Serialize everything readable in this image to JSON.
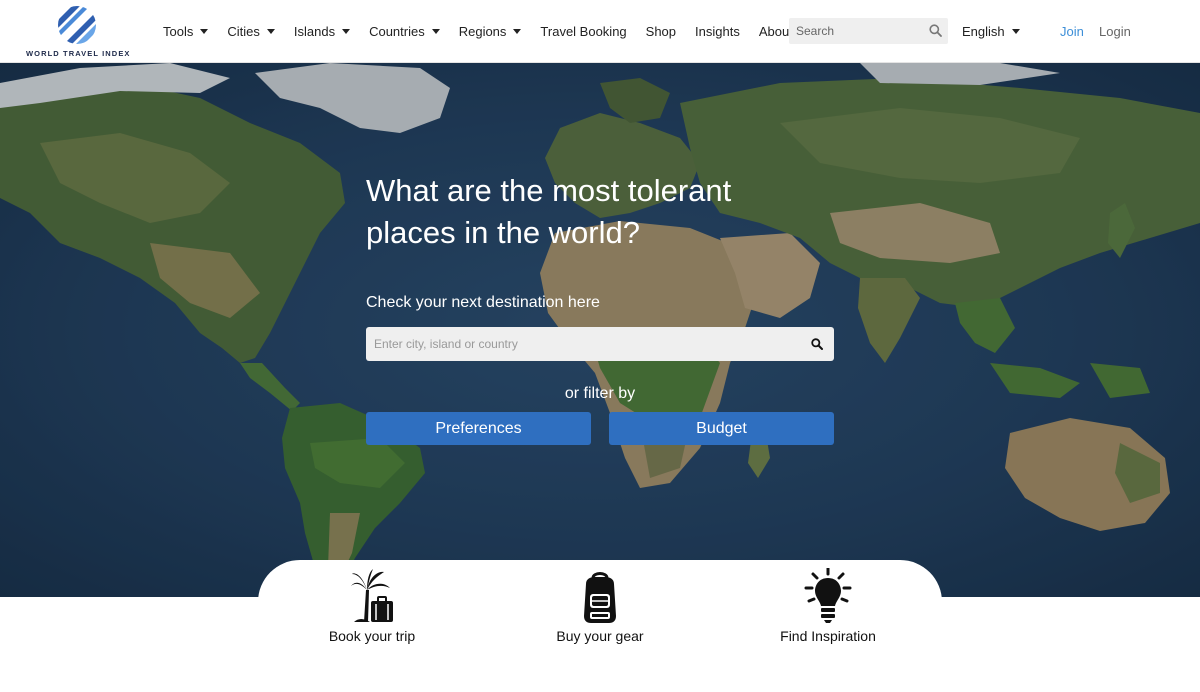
{
  "brand": {
    "name": "WORLD TRAVEL INDEX",
    "accent": "#3d8fd8",
    "button_color": "#2f6fc0"
  },
  "nav": {
    "items": [
      {
        "label": "Tools",
        "dropdown": true
      },
      {
        "label": "Cities",
        "dropdown": true
      },
      {
        "label": "Islands",
        "dropdown": true
      },
      {
        "label": "Countries",
        "dropdown": true
      },
      {
        "label": "Regions",
        "dropdown": true
      },
      {
        "label": "Travel Booking",
        "dropdown": false
      },
      {
        "label": "Shop",
        "dropdown": false
      },
      {
        "label": "Insights",
        "dropdown": false
      },
      {
        "label": "About",
        "dropdown": false
      }
    ],
    "search_placeholder": "Search",
    "language": "English",
    "join": "Join",
    "login": "Login"
  },
  "hero": {
    "title_line1": "What are the most tolerant",
    "title_line2": "places in the world?",
    "subtitle": "Check your next destination here",
    "search_placeholder": "Enter city, island or country",
    "filter_text": "or filter by",
    "buttons": {
      "preferences": "Preferences",
      "budget": "Budget"
    }
  },
  "features": [
    {
      "label": "Book your trip",
      "icon": "palm-suitcase-icon"
    },
    {
      "label": "Buy your gear",
      "icon": "backpack-icon"
    },
    {
      "label": "Find Inspiration",
      "icon": "lightbulb-icon"
    }
  ]
}
